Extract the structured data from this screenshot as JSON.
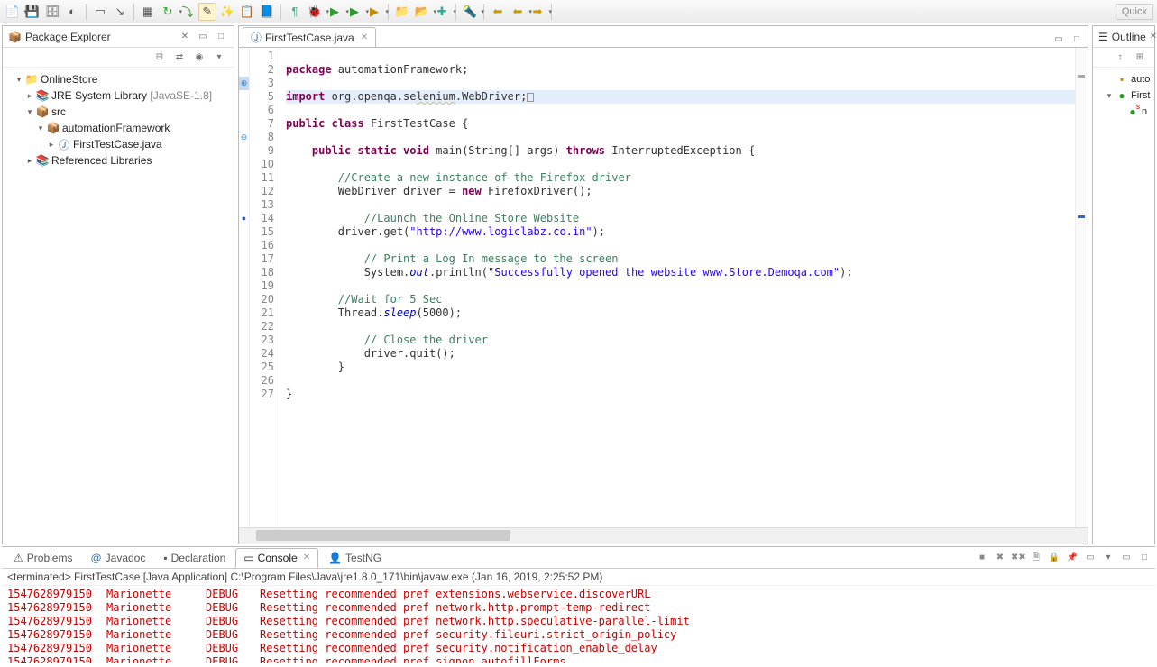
{
  "quick_access": "Quick",
  "package_explorer": {
    "title": "Package Explorer",
    "project": "OnlineStore",
    "jre": "JRE System Library",
    "jre_meta": "[JavaSE-1.8]",
    "src": "src",
    "pkg": "automationFramework",
    "file": "FirstTestCase.java",
    "reflib": "Referenced Libraries"
  },
  "editor": {
    "tab": "FirstTestCase.java",
    "lines": [
      "1",
      "2",
      "3",
      "5",
      "6",
      "7",
      "8",
      "9",
      "10",
      "11",
      "12",
      "13",
      "14",
      "15",
      "16",
      "17",
      "18",
      "19",
      "20",
      "21",
      "22",
      "23",
      "24",
      "25",
      "26",
      "27"
    ],
    "code": {
      "l1a": "package",
      "l1b": " automationFramework;",
      "l3a": "import",
      "l3b": " org.openqa.se",
      "l3c": "lenium",
      "l3d": ".WebDriver;",
      "l6a": "public",
      "l6b": " class",
      "l6c": " FirstTestCase {",
      "l8a": "    public",
      "l8b": " static",
      "l8c": " void",
      "l8d": " main(String[] args) ",
      "l8e": "throws",
      "l8f": " InterruptedException {",
      "l10": "        //Create a new instance of the Firefox driver",
      "l11a": "        WebDriver driver = ",
      "l11b": "new",
      "l11c": " FirefoxDriver();",
      "l13": "            //Launch the Online Store Website",
      "l14a": "        driver.get(",
      "l14b": "\"http://www.logiclabz.co.in\"",
      "l14c": ");",
      "l16": "            // Print a Log In message to the screen",
      "l17a": "            System.",
      "l17b": "out",
      "l17c": ".println(",
      "l17d": "\"Successfully opened the website www.Store.Demoqa.com\"",
      "l17e": ");",
      "l19": "        //Wait for 5 Sec",
      "l20a": "        Thread.",
      "l20b": "sleep",
      "l20c": "(5000);",
      "l22": "            // Close the driver",
      "l23": "            driver.quit();",
      "l24": "        }",
      "l26": "}",
      "empty": ""
    }
  },
  "outline": {
    "title": "Outline",
    "pkg": "auto",
    "cls": "First",
    "mth": "n"
  },
  "bottom_tabs": {
    "problems": "Problems",
    "javadoc": "Javadoc",
    "declaration": "Declaration",
    "console": "Console",
    "testng": "TestNG"
  },
  "terminated": "<terminated> FirstTestCase [Java Application] C:\\Program Files\\Java\\jre1.8.0_171\\bin\\javaw.exe (Jan 16, 2019, 2:25:52 PM)",
  "console_rows": [
    {
      "ts": "1547628979150",
      "src": "Marionette",
      "lvl": "DEBUG",
      "msg": "Resetting recommended pref extensions.webservice.discoverURL"
    },
    {
      "ts": "1547628979150",
      "src": "Marionette",
      "lvl": "DEBUG",
      "msg": "Resetting recommended pref network.http.prompt-temp-redirect"
    },
    {
      "ts": "1547628979150",
      "src": "Marionette",
      "lvl": "DEBUG",
      "msg": "Resetting recommended pref network.http.speculative-parallel-limit"
    },
    {
      "ts": "1547628979150",
      "src": "Marionette",
      "lvl": "DEBUG",
      "msg": "Resetting recommended pref security.fileuri.strict_origin_policy"
    },
    {
      "ts": "1547628979150",
      "src": "Marionette",
      "lvl": "DEBUG",
      "msg": "Resetting recommended pref security.notification_enable_delay"
    },
    {
      "ts": "1547628979150",
      "src": "Marionette",
      "lvl": "DEBUG",
      "msg": "Resetting recommended pref signon.autofillForms"
    }
  ]
}
